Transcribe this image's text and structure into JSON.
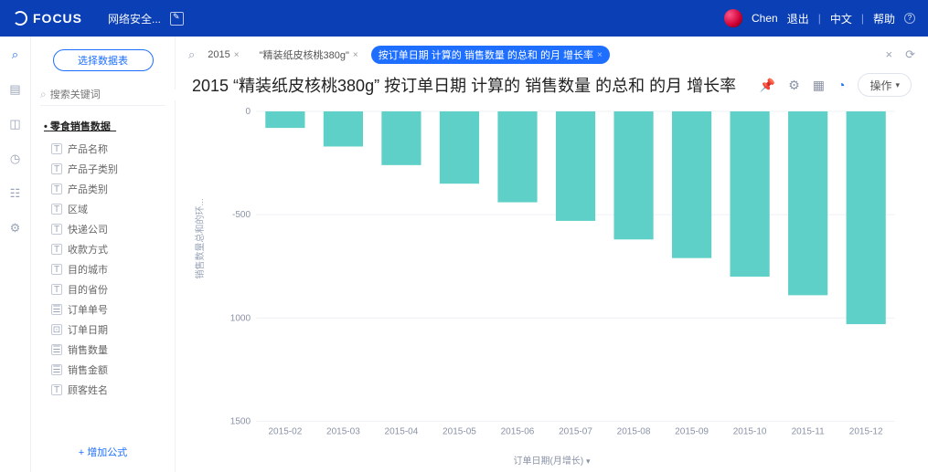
{
  "header": {
    "brand": "FOCUS",
    "tab": "网络安全...",
    "user": "Chen",
    "logout": "退出",
    "lang": "中文",
    "help": "帮助"
  },
  "sidebar": {
    "choose": "选择数据表",
    "search_ph": "搜索关键词",
    "section": "零食销售数据_",
    "cols": [
      "产品名称",
      "产品子类别",
      "产品类别",
      "区域",
      "快递公司",
      "收款方式",
      "目的城市",
      "目的省份",
      "订单单号",
      "订单日期",
      "销售数量",
      "销售金额",
      "顾客姓名"
    ],
    "addformula": "+ 增加公式"
  },
  "query": {
    "p1": "2015",
    "p2": "\"精装纸皮核桃380g\"",
    "p3": "按订单日期 计算的 销售数量 的总和 的月 增长率"
  },
  "title": "2015 “精装纸皮核桃380g”  按订单日期 计算的 销售数量 的总和 的月 增长率",
  "ops": "操作",
  "chart_data": {
    "type": "bar",
    "categories": [
      "2015-02",
      "2015-03",
      "2015-04",
      "2015-05",
      "2015-06",
      "2015-07",
      "2015-08",
      "2015-09",
      "2015-10",
      "2015-11",
      "2015-12"
    ],
    "values": [
      -80,
      -170,
      -260,
      -350,
      -440,
      -530,
      -620,
      -710,
      -800,
      -890,
      -1030
    ],
    "ylim": [
      -1500,
      0
    ],
    "yticks": [
      0,
      -500,
      -1000,
      -1500
    ],
    "ylabel": "销售数量总和的环...",
    "xlabel": "订单日期(月增长)"
  }
}
